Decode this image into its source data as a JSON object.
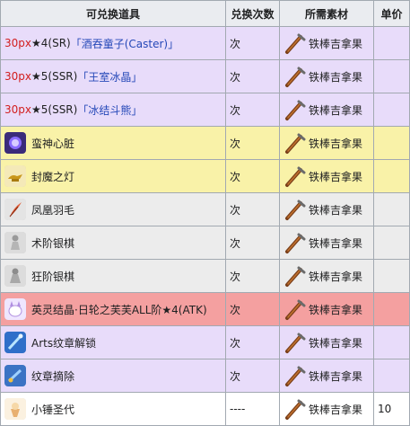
{
  "headers": [
    "可兑换道具",
    "兑换次数",
    "所需素材",
    "单价"
  ],
  "material": "铁棒吉拿果",
  "rows": [
    {
      "style": "purple",
      "prefix": "30px",
      "item": "★4(SR)",
      "link": "「酒吞童子(Caster)」",
      "icon": null,
      "count": "次",
      "price": ""
    },
    {
      "style": "purple",
      "prefix": "30px",
      "item": "★5(SSR)",
      "link": "「王室冰晶」",
      "icon": null,
      "count": "次",
      "price": ""
    },
    {
      "style": "purple",
      "prefix": "30px",
      "item": "★5(SSR)",
      "link": "「冰结斗熊」",
      "icon": null,
      "count": "次",
      "price": ""
    },
    {
      "style": "yellow",
      "prefix": "",
      "item": "蛮神心脏",
      "link": "",
      "icon": "beast-heart-icon",
      "count": "次",
      "price": ""
    },
    {
      "style": "yellow",
      "prefix": "",
      "item": "封魔之灯",
      "link": "",
      "icon": "magic-lamp-icon",
      "count": "次",
      "price": ""
    },
    {
      "style": "grey",
      "prefix": "",
      "item": "凤凰羽毛",
      "link": "",
      "icon": "phoenix-feather-icon",
      "count": "次",
      "price": ""
    },
    {
      "style": "grey",
      "prefix": "",
      "item": "术阶银棋",
      "link": "",
      "icon": "caster-silver-piece-icon",
      "count": "次",
      "price": ""
    },
    {
      "style": "grey",
      "prefix": "",
      "item": "狂阶银棋",
      "link": "",
      "icon": "berserker-silver-piece-icon",
      "count": "次",
      "price": ""
    },
    {
      "style": "red",
      "prefix": "",
      "item": "英灵结晶·日轮之芙芙ALL阶★4(ATK)",
      "link": "",
      "icon": "fou-crystal-icon",
      "count": "次",
      "price": ""
    },
    {
      "style": "purple",
      "prefix": "",
      "item": "Arts纹章解锁",
      "link": "",
      "icon": "arts-unlock-icon",
      "count": "次",
      "price": ""
    },
    {
      "style": "purple",
      "prefix": "",
      "item": "纹章摘除",
      "link": "",
      "icon": "code-remover-icon",
      "count": "次",
      "price": ""
    },
    {
      "style": "white",
      "prefix": "",
      "item": "小锤圣代",
      "link": "",
      "icon": "hammer-sundae-icon",
      "count": "----",
      "price": "10"
    }
  ],
  "colors": {
    "purple_row": "#e8dcfa",
    "yellow_row": "#f9f2a8",
    "grey_row": "#ececec",
    "red_row": "#f4a0a0",
    "header": "#eaecf0",
    "prefix_red": "#d21e1e",
    "link_blue": "#2548b8"
  }
}
